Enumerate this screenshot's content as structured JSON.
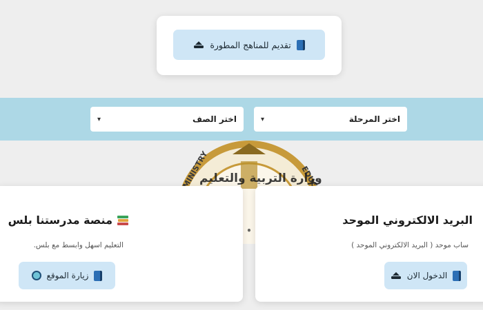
{
  "top": {
    "apply_button_label": "تقديم للمناهج المطورة",
    "icons": [
      "book-icon",
      "upload-tray-icon"
    ]
  },
  "filters": {
    "stage_select": "اختر المرحلة",
    "grade_select": "اختر الصف"
  },
  "background_logo": {
    "description_icon": "ministry-of-education-seal",
    "text_ar": "وزارة التربية والتعليم",
    "text_en": "MINISTRY OF EDUCATION"
  },
  "cards": [
    {
      "title": "منصة مدرستنا بلس",
      "description": "التعليم اسهل وابسط مع بلس.",
      "button_label": "زيارة الموقع",
      "icons": [
        "books-icon",
        "globe-icon",
        "book-icon"
      ]
    },
    {
      "title": "البريد الالكتروني الموحد",
      "description": "ساب موحد ( البريد الالكتروني الموحد )",
      "button_label": "الدخول الان",
      "icons": [
        "upload-tray-icon",
        "book-icon"
      ]
    }
  ],
  "colors": {
    "button_bg": "#cfe6f6",
    "band_bg": "#add8e6",
    "page_bg": "#eeeeee",
    "book_icon": "#2c6fb5"
  }
}
